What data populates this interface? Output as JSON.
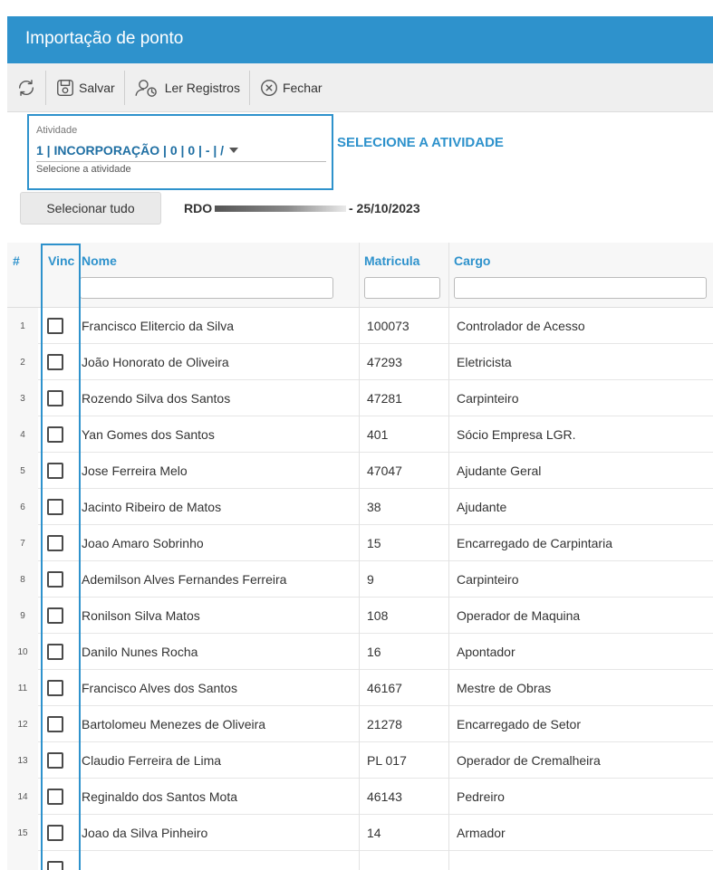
{
  "window": {
    "title": "Importação de ponto"
  },
  "toolbar": {
    "refresh_icon": "refresh-icon",
    "save_label": "Salvar",
    "read_label": "Ler Registros",
    "close_label": "Fechar"
  },
  "atividade": {
    "caption": "Atividade",
    "value": "1 | INCORPORAÇÃO | 0 | 0 | - | /",
    "hint": "Selecione a atividade",
    "call_to_action": "SELECIONE A ATIVIDADE"
  },
  "actions": {
    "select_all_label": "Selecionar tudo"
  },
  "rdo": {
    "label": "RDO",
    "date": "- 25/10/2023"
  },
  "grid": {
    "columns": {
      "num": "#",
      "vinc": "Vinc",
      "nome": "Nome",
      "matricula": "Matricula",
      "cargo": "Cargo"
    },
    "rows": [
      {
        "num": "1",
        "nome": "Francisco Elitercio da Silva",
        "matricula": "100073",
        "cargo": "Controlador de Acesso"
      },
      {
        "num": "2",
        "nome": "João Honorato de Oliveira",
        "matricula": "47293",
        "cargo": "Eletricista"
      },
      {
        "num": "3",
        "nome": "Rozendo Silva dos Santos",
        "matricula": "47281",
        "cargo": "Carpinteiro"
      },
      {
        "num": "4",
        "nome": "Yan Gomes dos Santos",
        "matricula": "401",
        "cargo": "Sócio Empresa LGR."
      },
      {
        "num": "5",
        "nome": "Jose Ferreira Melo",
        "matricula": "47047",
        "cargo": "Ajudante Geral"
      },
      {
        "num": "6",
        "nome": "Jacinto Ribeiro de Matos",
        "matricula": "38",
        "cargo": "Ajudante"
      },
      {
        "num": "7",
        "nome": "Joao Amaro Sobrinho",
        "matricula": "15",
        "cargo": "Encarregado de Carpintaria"
      },
      {
        "num": "8",
        "nome": "Ademilson Alves Fernandes Ferreira",
        "matricula": "9",
        "cargo": "Carpinteiro"
      },
      {
        "num": "9",
        "nome": "Ronilson Silva Matos",
        "matricula": "108",
        "cargo": "Operador de Maquina"
      },
      {
        "num": "10",
        "nome": "Danilo Nunes Rocha",
        "matricula": "16",
        "cargo": "Apontador"
      },
      {
        "num": "11",
        "nome": "Francisco Alves dos Santos",
        "matricula": "46167",
        "cargo": "Mestre de Obras"
      },
      {
        "num": "12",
        "nome": "Bartolomeu Menezes de Oliveira",
        "matricula": "21278",
        "cargo": "Encarregado de Setor"
      },
      {
        "num": "13",
        "nome": "Claudio Ferreira de Lima",
        "matricula": "PL 017",
        "cargo": "Operador de Cremalheira"
      },
      {
        "num": "14",
        "nome": "Reginaldo dos Santos Mota",
        "matricula": "46143",
        "cargo": "Pedreiro"
      },
      {
        "num": "15",
        "nome": "Joao da Silva Pinheiro",
        "matricula": "14",
        "cargo": "Armador"
      }
    ]
  },
  "colors": {
    "accent": "#2e92cc",
    "title_bar": "#2e92cc",
    "toolbar_bg": "#efefef"
  }
}
